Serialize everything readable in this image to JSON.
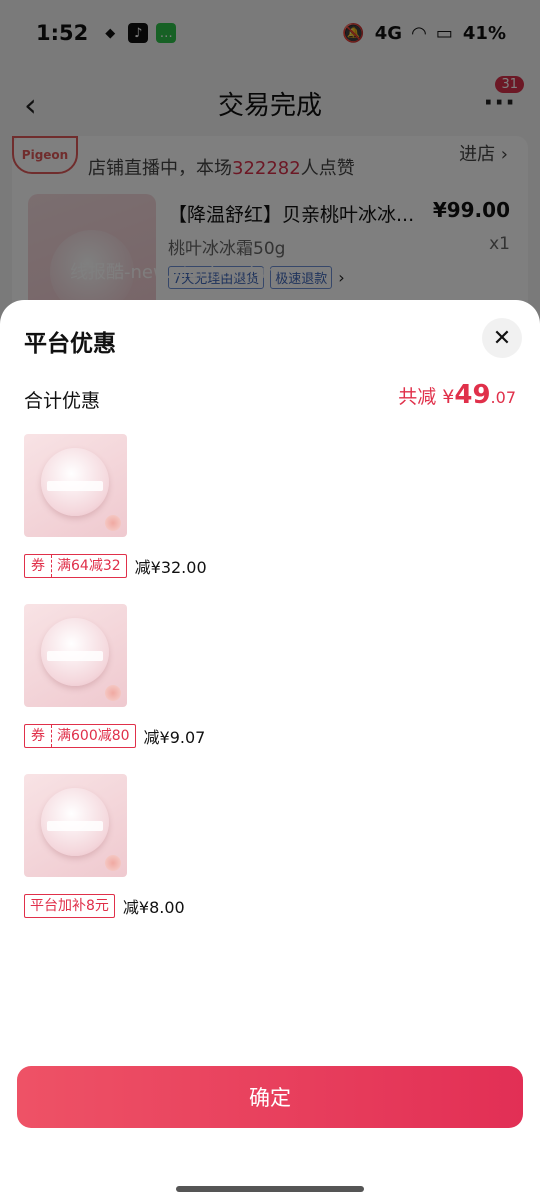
{
  "status_bar": {
    "time": "1:52",
    "signal": "4G",
    "battery": "41%"
  },
  "nav": {
    "title": "交易完成",
    "badge": "31"
  },
  "order": {
    "shop_logo": "Pigeon",
    "live_prefix": "店铺直播中，本场",
    "live_count": "322282",
    "live_suffix": "人点赞",
    "enter_store": "进店 ›",
    "product_title": "【降温舒红】贝亲桃叶冰冰...",
    "price": "¥99.00",
    "spec": "桃叶冰冰霜50g",
    "qty": "x1",
    "tag1": "7天无理由退货",
    "tag2": "极速退款",
    "watermark": "线报酷-new.xianbao.fun"
  },
  "sheet": {
    "title": "平台优惠",
    "summary_label": "合计优惠",
    "summary_prefix": "共减 ¥",
    "summary_int": "49",
    "summary_dec": ".07",
    "items": [
      {
        "badge_tag": "券",
        "badge_desc": "满64减32",
        "reduce": "减¥32.00"
      },
      {
        "badge_tag": "券",
        "badge_desc": "满600减80",
        "reduce": "减¥9.07"
      },
      {
        "badge_plain": "平台加补8元",
        "reduce": "减¥8.00"
      }
    ],
    "confirm_label": "确定"
  }
}
